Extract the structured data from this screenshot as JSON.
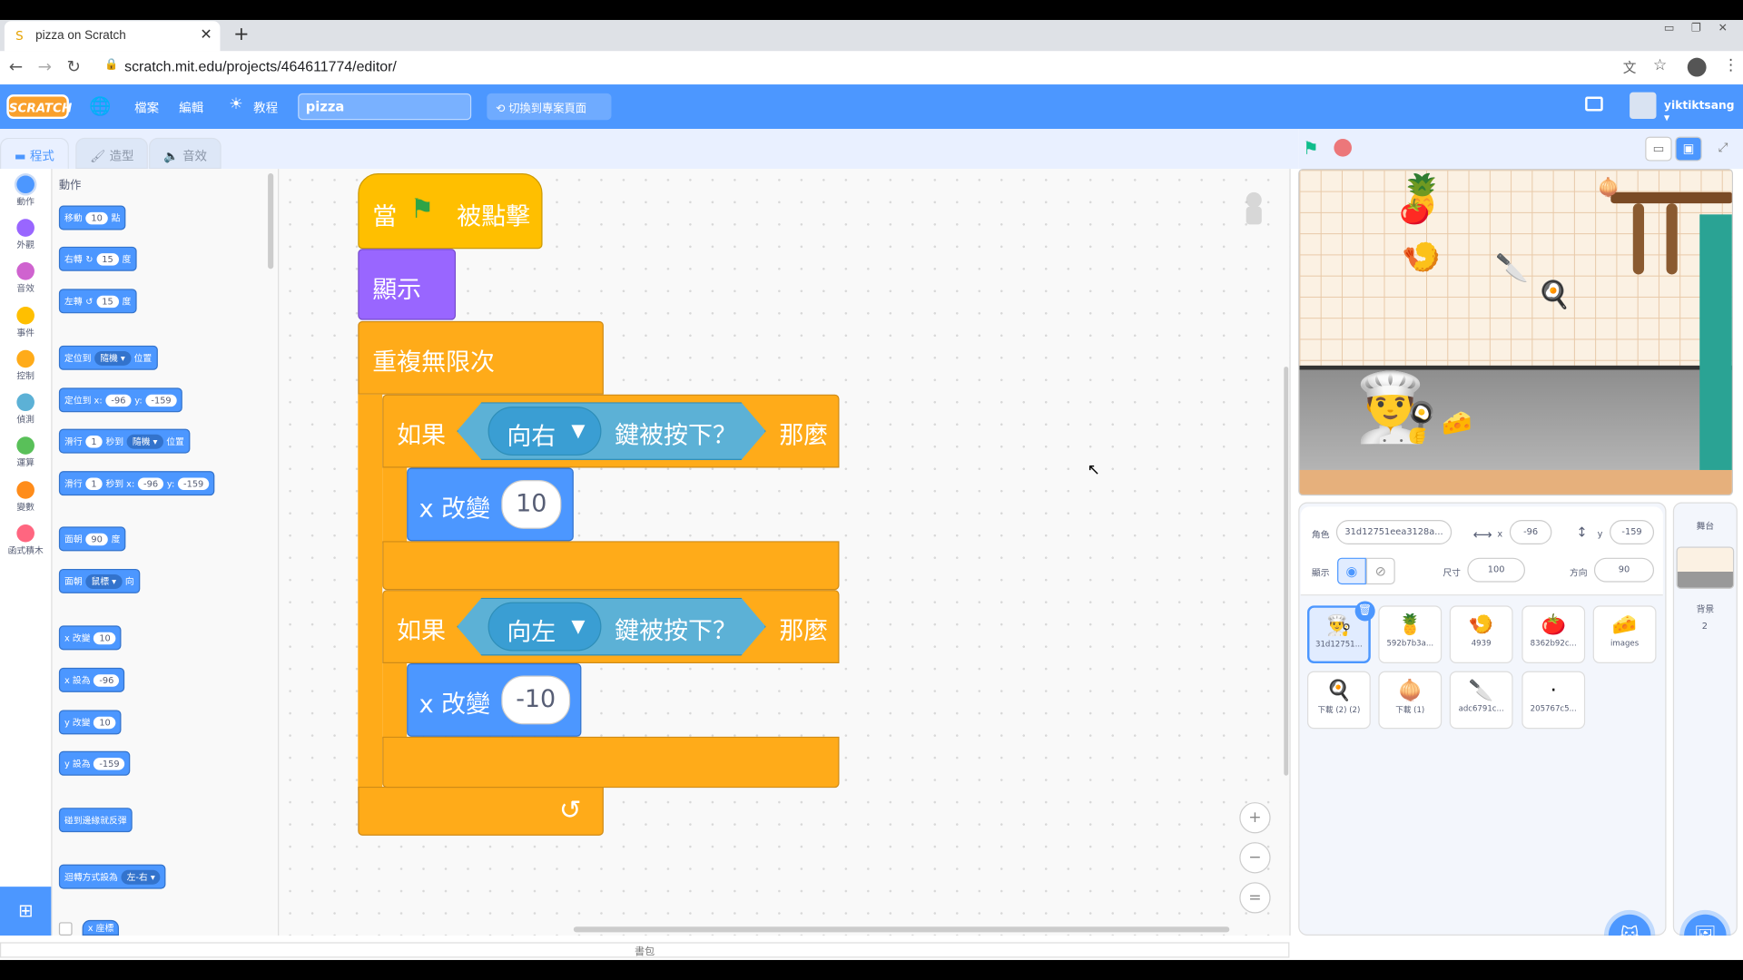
{
  "browser": {
    "tab_title": "pizza on Scratch",
    "url": "scratch.mit.edu/projects/464611774/editor/"
  },
  "menubar": {
    "logo": "SCRATCH",
    "file": "檔案",
    "edit": "編輯",
    "tutorials": "教程",
    "project_title": "pizza",
    "see_project_page": "切換到專案頁面",
    "username": "yiktiktsang"
  },
  "editor_tabs": [
    "程式",
    "造型",
    "音效"
  ],
  "categories": [
    {
      "label": "動作",
      "color": "#4c97ff"
    },
    {
      "label": "外觀",
      "color": "#9966ff"
    },
    {
      "label": "音效",
      "color": "#cf63cf"
    },
    {
      "label": "事件",
      "color": "#ffbf00"
    },
    {
      "label": "控制",
      "color": "#ffab19"
    },
    {
      "label": "偵測",
      "color": "#5cb1d6"
    },
    {
      "label": "運算",
      "color": "#59c059"
    },
    {
      "label": "變數",
      "color": "#ff8c1a"
    },
    {
      "label": "函式積木",
      "color": "#ff6680"
    }
  ],
  "palette": {
    "title": "動作",
    "blocks": {
      "move": {
        "a": "移動",
        "v": "10",
        "b": "點"
      },
      "turn_right": {
        "a": "右轉",
        "v": "15",
        "b": "度"
      },
      "turn_left": {
        "a": "左轉",
        "v": "15",
        "b": "度"
      },
      "goto": {
        "a": "定位到",
        "d": "隨機",
        "b": "位置"
      },
      "goto_xy": {
        "a": "定位到 x:",
        "x": "-96",
        "b": "y:",
        "y": "-159"
      },
      "glide": {
        "a": "滑行",
        "v": "1",
        "b": "秒到",
        "d": "隨機",
        "c": "位置"
      },
      "glide_xy": {
        "a": "滑行",
        "v": "1",
        "b": "秒到 x:",
        "x": "-96",
        "c": "y:",
        "y": "-159"
      },
      "point_dir": {
        "a": "面朝",
        "v": "90",
        "b": "度"
      },
      "point_towards": {
        "a": "面朝",
        "d": "鼠標",
        "b": "向"
      },
      "change_x": {
        "a": "x 改變",
        "v": "10"
      },
      "set_x": {
        "a": "x 設為",
        "v": "-96"
      },
      "change_y": {
        "a": "y 改變",
        "v": "10"
      },
      "set_y": {
        "a": "y 設為",
        "v": "-159"
      },
      "bounce": {
        "a": "碰到邊緣就反彈"
      },
      "rotation": {
        "a": "迴轉方式設為",
        "d": "左-右"
      },
      "x_pos": {
        "a": "x 座標"
      }
    }
  },
  "script": {
    "hat_when": "當",
    "hat_clicked": "被點擊",
    "show": "顯示",
    "forever": "重複無限次",
    "if1": {
      "if": "如果",
      "key": "向右",
      "pressed": "鍵被按下？",
      "then": "那麼",
      "action": "x 改變",
      "value": "10"
    },
    "if2": {
      "if": "如果",
      "key": "向左",
      "pressed": "鍵被按下？",
      "then": "那麼",
      "action": "x 改變",
      "value": "-10"
    }
  },
  "sprite_info": {
    "sprite_label": "角色",
    "sprite_name": "31d12751eea3128a...",
    "x_label": "x",
    "x": "-96",
    "y_label": "y",
    "y": "-159",
    "show_label": "顯示",
    "size_label": "尺寸",
    "size": "100",
    "direction_label": "方向",
    "direction": "90"
  },
  "sprites": [
    {
      "name": "31d12751...",
      "icon": "chef-icon"
    },
    {
      "name": "592b7b3a...",
      "icon": "pineapple-icon"
    },
    {
      "name": "4939",
      "icon": "shrimp-icon"
    },
    {
      "name": "8362b92c...",
      "icon": "tomato-icon"
    },
    {
      "name": "images",
      "icon": "cheese-icon"
    },
    {
      "name": "下載 (2) (2)",
      "icon": "egg-icon"
    },
    {
      "name": "下載 (1)",
      "icon": "onion-icon"
    },
    {
      "name": "adc6791c...",
      "icon": "knife-icon"
    },
    {
      "name": "205767c5...",
      "icon": "dot-icon"
    }
  ],
  "stage_pane": {
    "title": "舞台",
    "backdrops_label": "背景",
    "backdrops_count": "2"
  },
  "backpack": "書包"
}
